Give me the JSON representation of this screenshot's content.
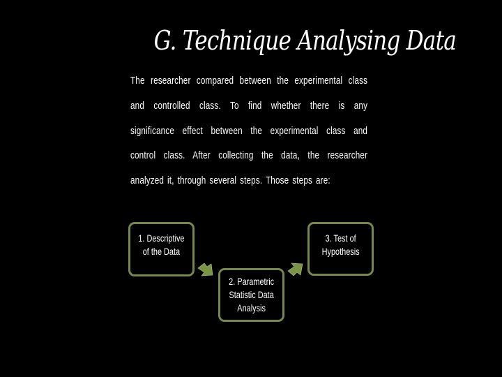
{
  "slide": {
    "title": "G. Technique Analysing Data",
    "body": "The researcher compared between the experimental class and controlled class. To find whether there is any significance effect between the experimental class and control class. After collecting the data, the researcher analyzed it, through several steps. Those steps are:"
  },
  "flow": {
    "steps": [
      {
        "label": "1. Descriptive\nof the Data"
      },
      {
        "label": "2. Parametric\nStatistic Data\nAnalysis"
      },
      {
        "label": "3. Test of\nHypothesis"
      }
    ],
    "arrows": [
      {
        "icon": "arrow-right-down-icon"
      },
      {
        "icon": "arrow-right-up-icon"
      }
    ]
  },
  "colors": {
    "background": "#000000",
    "text": "#ffffff",
    "box_border": "#76894a",
    "arrow_fill": "#7a9543"
  }
}
